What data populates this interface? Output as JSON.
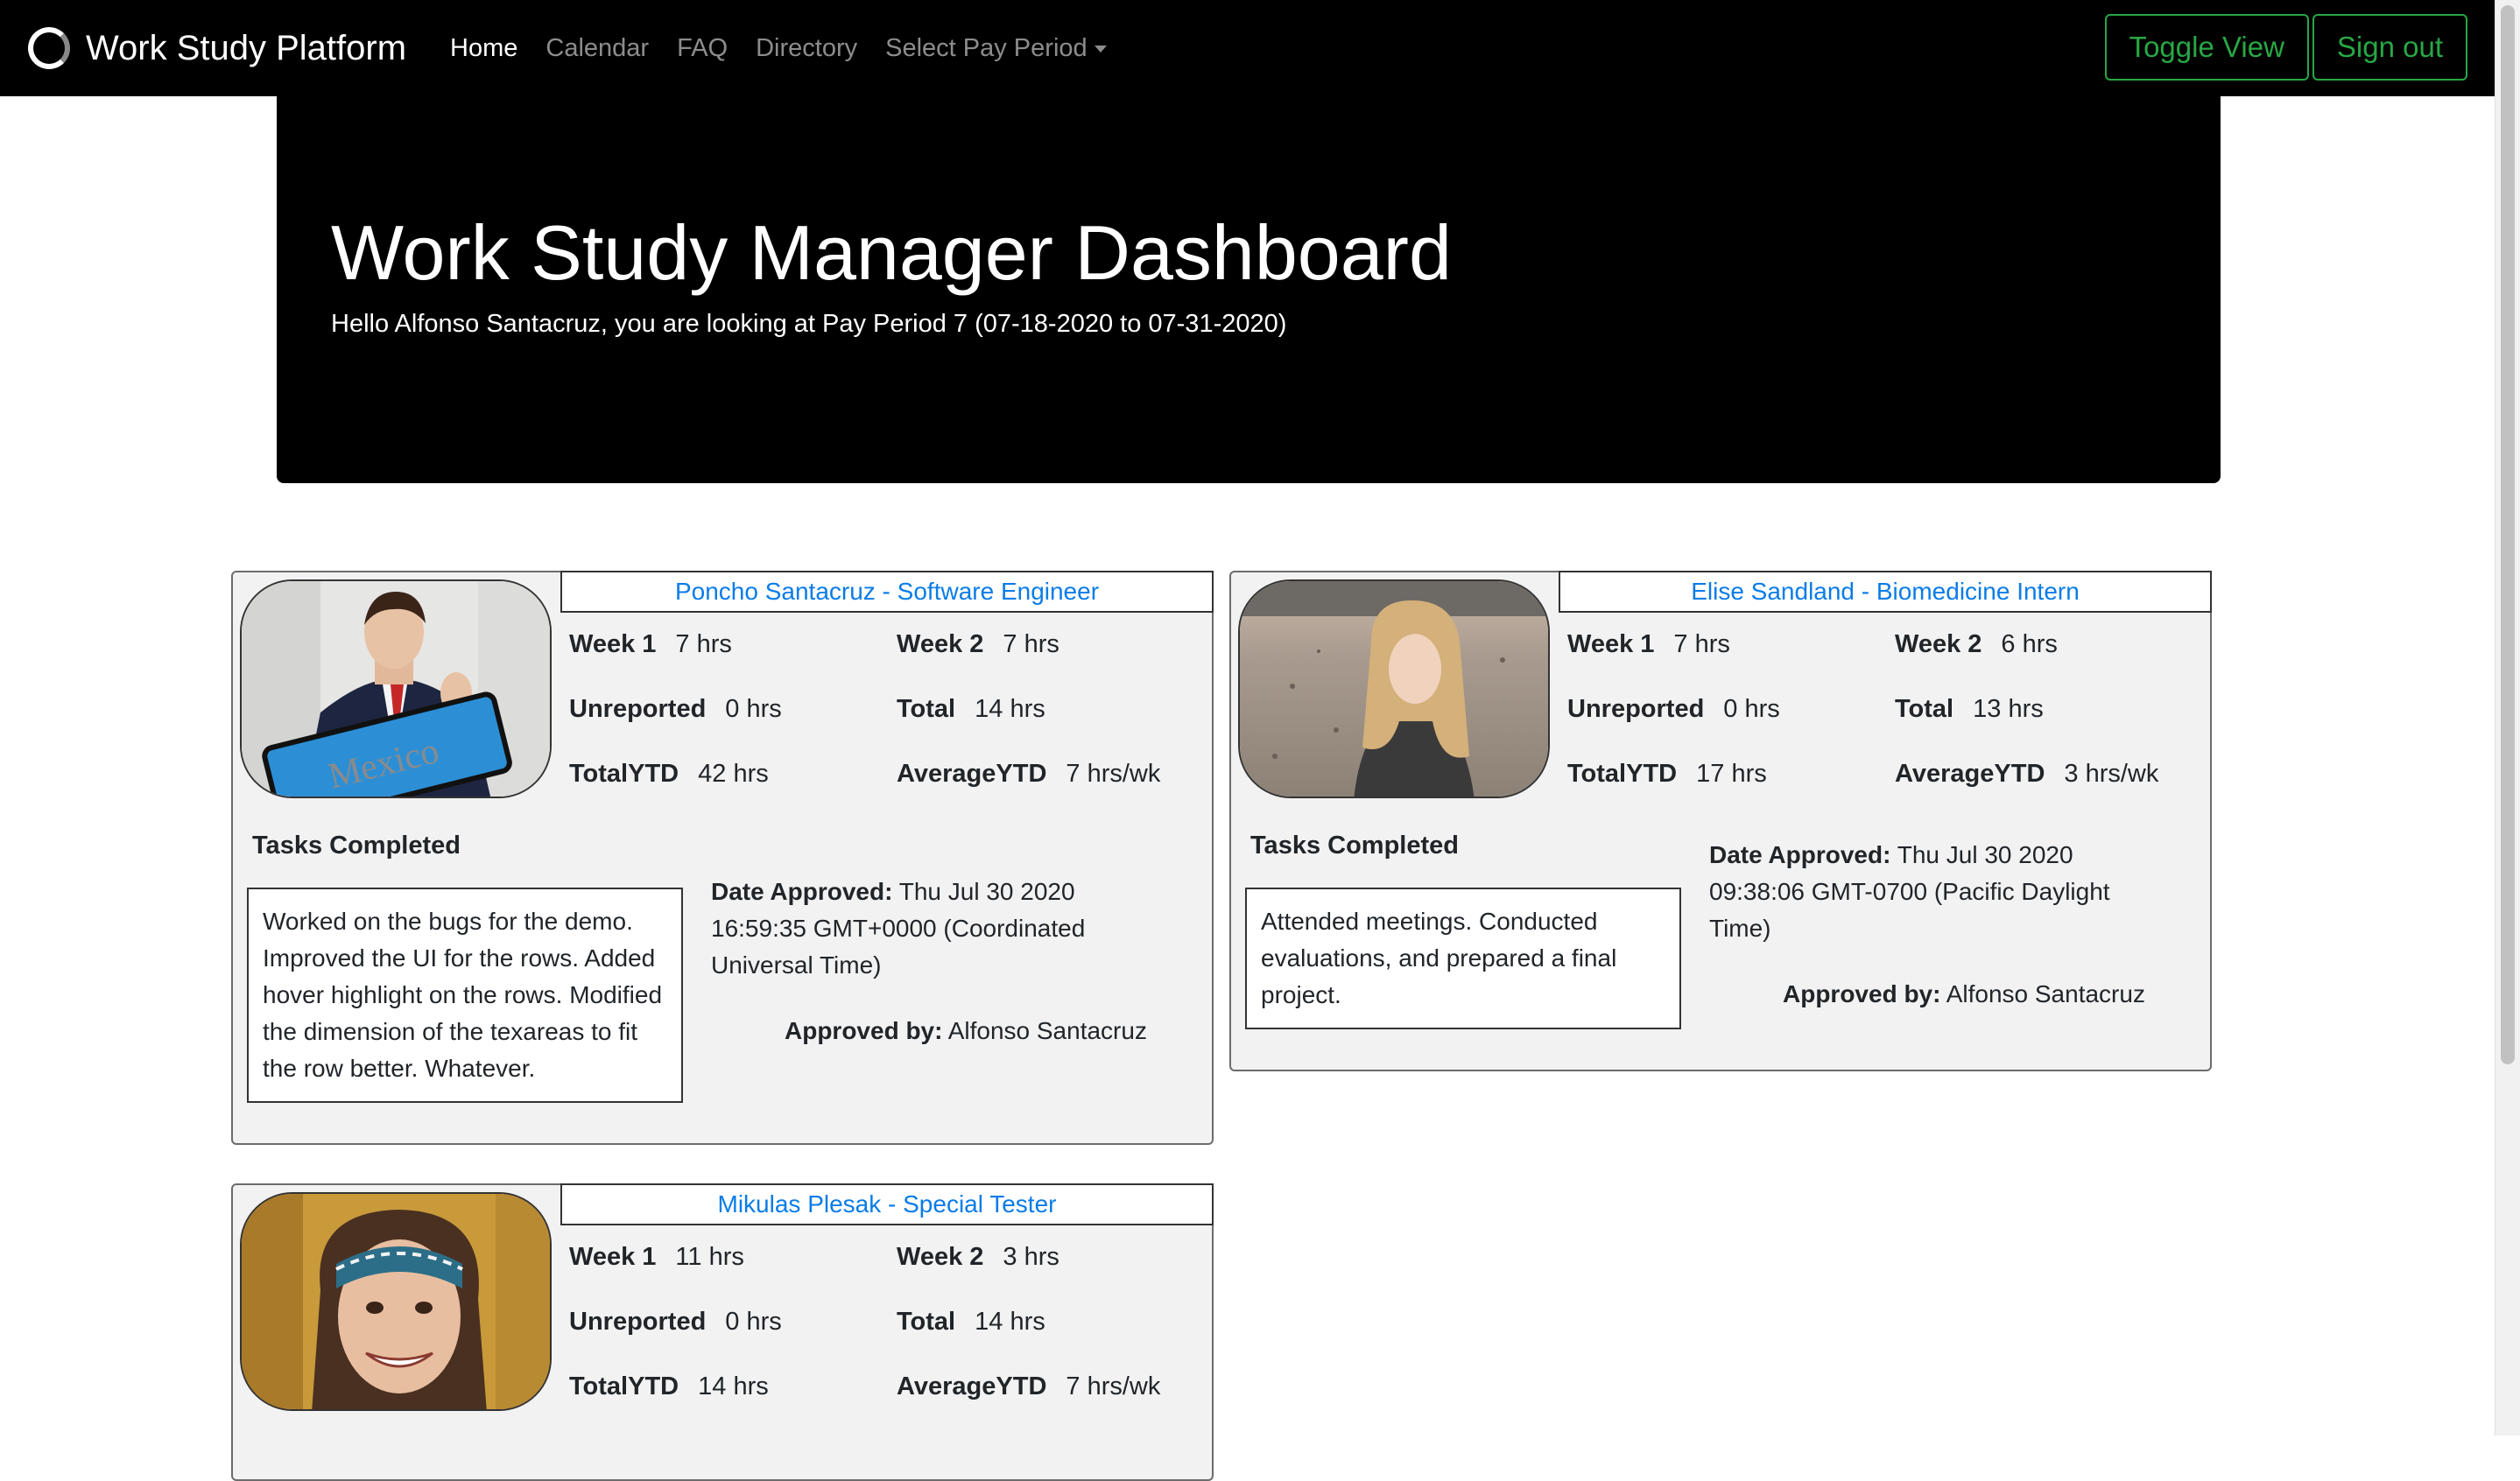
{
  "navbar": {
    "brand": "Work Study Platform",
    "links": [
      "Home",
      "Calendar",
      "FAQ",
      "Directory"
    ],
    "pay_period_dropdown": "Select Pay Period",
    "toggle_view": "Toggle View",
    "sign_out": "Sign out",
    "accent_color": "#28a745"
  },
  "jumbotron": {
    "title": "Work Study Manager Dashboard",
    "subtitle": "Hello Alfonso Santacruz, you are looking at Pay Period 7 (07-18-2020 to 07-31-2020)"
  },
  "labels": {
    "week1": "Week 1",
    "week2": "Week 2",
    "unreported": "Unreported",
    "total": "Total",
    "total_ytd": "TotalYTD",
    "average_ytd": "AverageYTD",
    "tasks_completed": "Tasks Completed",
    "date_approved": "Date Approved:",
    "approved_by": "Approved by:"
  },
  "students": [
    {
      "name": "Poncho Santacruz - Software Engineer",
      "week1": "7 hrs",
      "week2": "7 hrs",
      "unreported": "0 hrs",
      "total": "14 hrs",
      "total_ytd": "42 hrs",
      "average_ytd": "7 hrs/wk",
      "tasks": "Worked on the bugs for the demo. Improved the UI for the rows. Added hover highlight on the rows. Modified the dimension of the texareas to fit the row better. Whatever.",
      "date_approved": "Thu Jul 30 2020 16:59:35 GMT+0000 (Coordinated Universal Time)",
      "approved_by": "Alfonso Santacruz",
      "photo_sign": "Mexico"
    },
    {
      "name": "Elise Sandland - Biomedicine Intern",
      "week1": "7 hrs",
      "week2": "6 hrs",
      "unreported": "0 hrs",
      "total": "13 hrs",
      "total_ytd": "17 hrs",
      "average_ytd": "3 hrs/wk",
      "tasks": "Attended meetings. Conducted evaluations, and prepared a final project.",
      "date_approved": "Thu Jul 30 2020 09:38:06 GMT-0700 (Pacific Daylight Time)",
      "approved_by": "Alfonso Santacruz"
    },
    {
      "name": "Mikulas Plesak - Special Tester",
      "week1": "11 hrs",
      "week2": "3 hrs",
      "unreported": "0 hrs",
      "total": "14 hrs",
      "total_ytd": "14 hrs",
      "average_ytd": "7 hrs/wk"
    }
  ]
}
